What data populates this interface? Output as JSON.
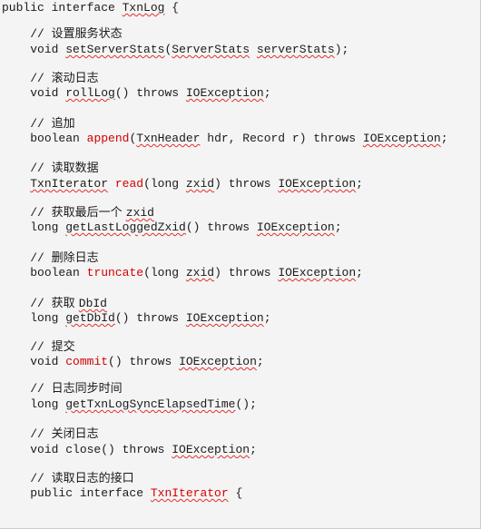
{
  "lines": [
    {
      "id": "l0",
      "kind": "code",
      "indent": "",
      "parts": [
        {
          "t": "public interface "
        },
        {
          "t": "TxnLog",
          "squig": true
        },
        {
          "t": " {"
        }
      ]
    },
    {
      "id": "l1",
      "kind": "comment",
      "indent": "    ",
      "slashes": "// ",
      "text": "设置服务状态"
    },
    {
      "id": "l2",
      "kind": "code",
      "indent": "    ",
      "parts": [
        {
          "t": "void "
        },
        {
          "t": "setServerStats",
          "squig": true
        },
        {
          "t": "("
        },
        {
          "t": "ServerStats",
          "squig": true
        },
        {
          "t": " "
        },
        {
          "t": "serverStats",
          "squig": true
        },
        {
          "t": ");"
        }
      ]
    },
    {
      "id": "l3",
      "kind": "comment",
      "indent": "    ",
      "slashes": "// ",
      "text": "滚动日志"
    },
    {
      "id": "l4",
      "kind": "code",
      "indent": "    ",
      "parts": [
        {
          "t": "void "
        },
        {
          "t": "rollLog",
          "squig": true
        },
        {
          "t": "() throws "
        },
        {
          "t": "IOException",
          "squig": true
        },
        {
          "t": ";"
        }
      ]
    },
    {
      "id": "l5",
      "kind": "comment",
      "indent": "    ",
      "slashes": "// ",
      "text": "追加"
    },
    {
      "id": "l6",
      "kind": "code",
      "indent": "    ",
      "parts": [
        {
          "t": "boolean "
        },
        {
          "t": "append",
          "red": true
        },
        {
          "t": "("
        },
        {
          "t": "TxnHeader",
          "squig": true
        },
        {
          "t": " hdr, Record r) throws "
        },
        {
          "t": "IOException",
          "squig": true
        },
        {
          "t": ";"
        }
      ]
    },
    {
      "id": "l7",
      "kind": "comment",
      "indent": "    ",
      "slashes": "// ",
      "text": "读取数据"
    },
    {
      "id": "l8",
      "kind": "code",
      "indent": "    ",
      "parts": [
        {
          "t": "TxnIterator",
          "squig": true
        },
        {
          "t": " "
        },
        {
          "t": "read",
          "red": true
        },
        {
          "t": "(long "
        },
        {
          "t": "zxid",
          "squig": true
        },
        {
          "t": ") throws "
        },
        {
          "t": "IOException",
          "squig": true
        },
        {
          "t": ";"
        }
      ]
    },
    {
      "id": "l9",
      "kind": "comment",
      "indent": "    ",
      "slashes": "// ",
      "text": "获取最后一个 ",
      "mono": "zxid",
      "monoSquig": true
    },
    {
      "id": "l10",
      "kind": "code",
      "indent": "    ",
      "parts": [
        {
          "t": "long "
        },
        {
          "t": "getLastLoggedZxid",
          "squig": true
        },
        {
          "t": "() throws "
        },
        {
          "t": "IOException",
          "squig": true
        },
        {
          "t": ";"
        }
      ]
    },
    {
      "id": "l11",
      "kind": "comment",
      "indent": "    ",
      "slashes": "// ",
      "text": "删除日志"
    },
    {
      "id": "l12",
      "kind": "code",
      "indent": "    ",
      "parts": [
        {
          "t": "boolean "
        },
        {
          "t": "truncate",
          "red": true
        },
        {
          "t": "(long "
        },
        {
          "t": "zxid",
          "squig": true
        },
        {
          "t": ") throws "
        },
        {
          "t": "IOException",
          "squig": true
        },
        {
          "t": ";"
        }
      ]
    },
    {
      "id": "l13",
      "kind": "comment",
      "indent": "    ",
      "slashes": "// ",
      "text": "获取 ",
      "mono": "DbId",
      "monoSquig": true
    },
    {
      "id": "l14",
      "kind": "code",
      "indent": "    ",
      "parts": [
        {
          "t": "long "
        },
        {
          "t": "getDbId",
          "squig": true
        },
        {
          "t": "() throws "
        },
        {
          "t": "IOException",
          "squig": true
        },
        {
          "t": ";"
        }
      ]
    },
    {
      "id": "l15",
      "kind": "comment",
      "indent": "    ",
      "slashes": "// ",
      "text": "提交"
    },
    {
      "id": "l16",
      "kind": "code",
      "indent": "    ",
      "parts": [
        {
          "t": "void "
        },
        {
          "t": "commit",
          "red": true
        },
        {
          "t": "() throws "
        },
        {
          "t": "IOException",
          "squig": true
        },
        {
          "t": ";"
        }
      ]
    },
    {
      "id": "l17",
      "kind": "comment",
      "indent": "    ",
      "slashes": "// ",
      "text": "日志同步时间"
    },
    {
      "id": "l18",
      "kind": "code",
      "indent": "    ",
      "parts": [
        {
          "t": "long "
        },
        {
          "t": "getTxnLogSyncElapsedTime",
          "squig": true
        },
        {
          "t": "();"
        }
      ]
    },
    {
      "id": "l19",
      "kind": "comment",
      "indent": "    ",
      "slashes": "// ",
      "text": "关闭日志"
    },
    {
      "id": "l20",
      "kind": "code",
      "indent": "    ",
      "parts": [
        {
          "t": "void close() throws "
        },
        {
          "t": "IOException",
          "squig": true
        },
        {
          "t": ";"
        }
      ]
    },
    {
      "id": "l21",
      "kind": "comment",
      "indent": "    ",
      "slashes": "// ",
      "text": "读取日志的接口"
    },
    {
      "id": "l22",
      "kind": "code",
      "indent": "    ",
      "parts": [
        {
          "t": "public interface "
        },
        {
          "t": "TxnIterator",
          "red": true,
          "squig": true
        },
        {
          "t": " {"
        }
      ]
    }
  ],
  "colors": {
    "keyword_red": "#d40000",
    "spell_underline": "#e03030",
    "background": "#f4f4f4",
    "text": "#1a1a1a"
  }
}
